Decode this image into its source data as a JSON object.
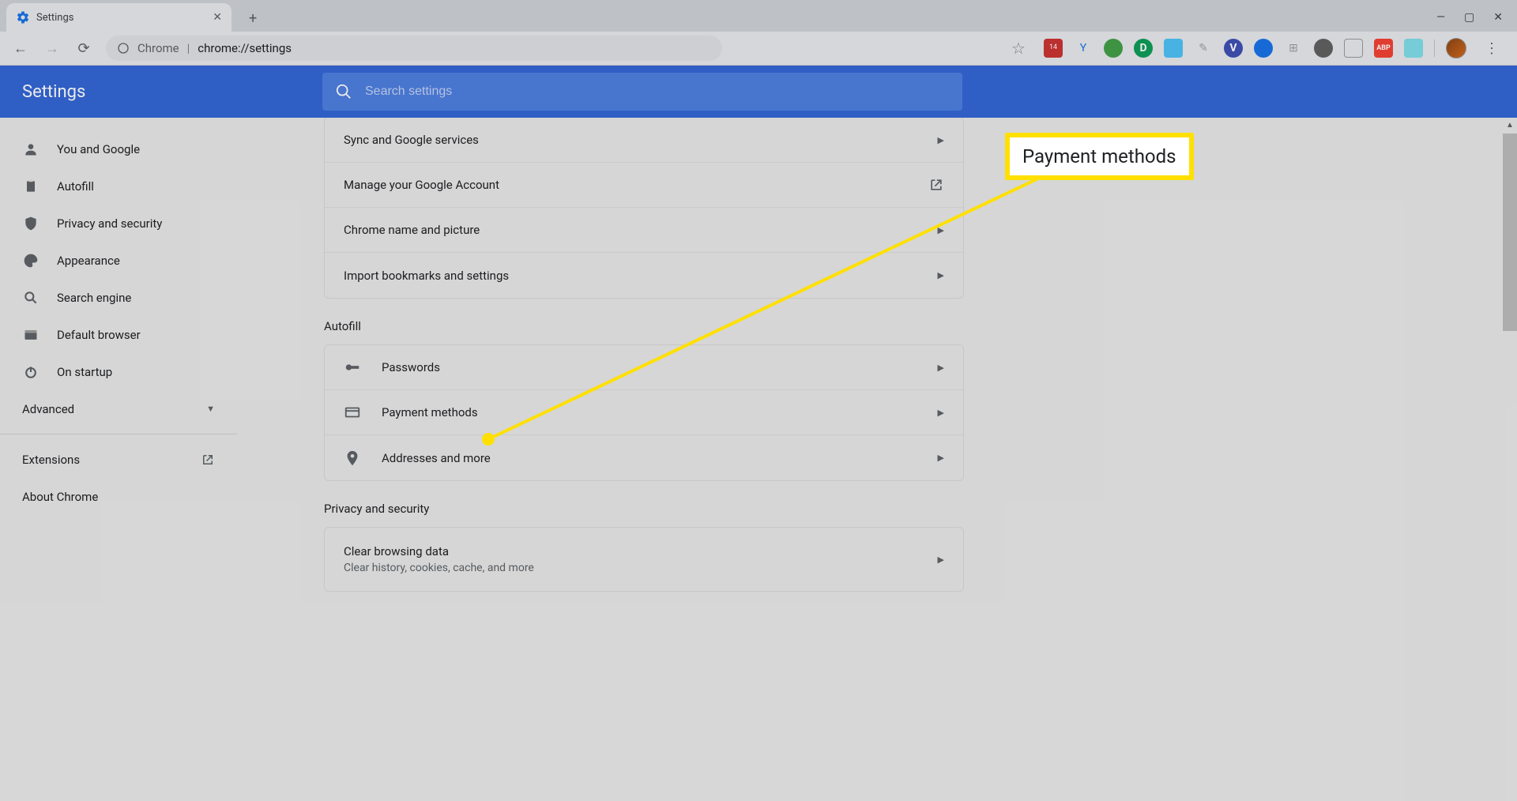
{
  "tab": {
    "title": "Settings"
  },
  "omnibox": {
    "proto": "Chrome",
    "url": "chrome://settings"
  },
  "extension_badge": "14",
  "header": {
    "title": "Settings"
  },
  "search": {
    "placeholder": "Search settings"
  },
  "sidebar": {
    "items": [
      {
        "label": "You and Google",
        "icon": "person"
      },
      {
        "label": "Autofill",
        "icon": "clipboard"
      },
      {
        "label": "Privacy and security",
        "icon": "shield"
      },
      {
        "label": "Appearance",
        "icon": "palette"
      },
      {
        "label": "Search engine",
        "icon": "search"
      },
      {
        "label": "Default browser",
        "icon": "browser"
      },
      {
        "label": "On startup",
        "icon": "power"
      }
    ],
    "advanced": "Advanced",
    "extensions": "Extensions",
    "about": "About Chrome"
  },
  "card1": {
    "rows": [
      {
        "label": "Sync and Google services"
      },
      {
        "label": "Manage your Google Account"
      },
      {
        "label": "Chrome name and picture"
      },
      {
        "label": "Import bookmarks and settings"
      }
    ]
  },
  "section_autofill": "Autofill",
  "card_autofill": {
    "rows": [
      {
        "label": "Passwords",
        "icon": "key"
      },
      {
        "label": "Payment methods",
        "icon": "card"
      },
      {
        "label": "Addresses and more",
        "icon": "pin"
      }
    ]
  },
  "section_privacy": "Privacy and security",
  "card_privacy": {
    "row1": {
      "label": "Clear browsing data",
      "sub": "Clear history, cookies, cache, and more"
    }
  },
  "callout_text": "Payment methods"
}
